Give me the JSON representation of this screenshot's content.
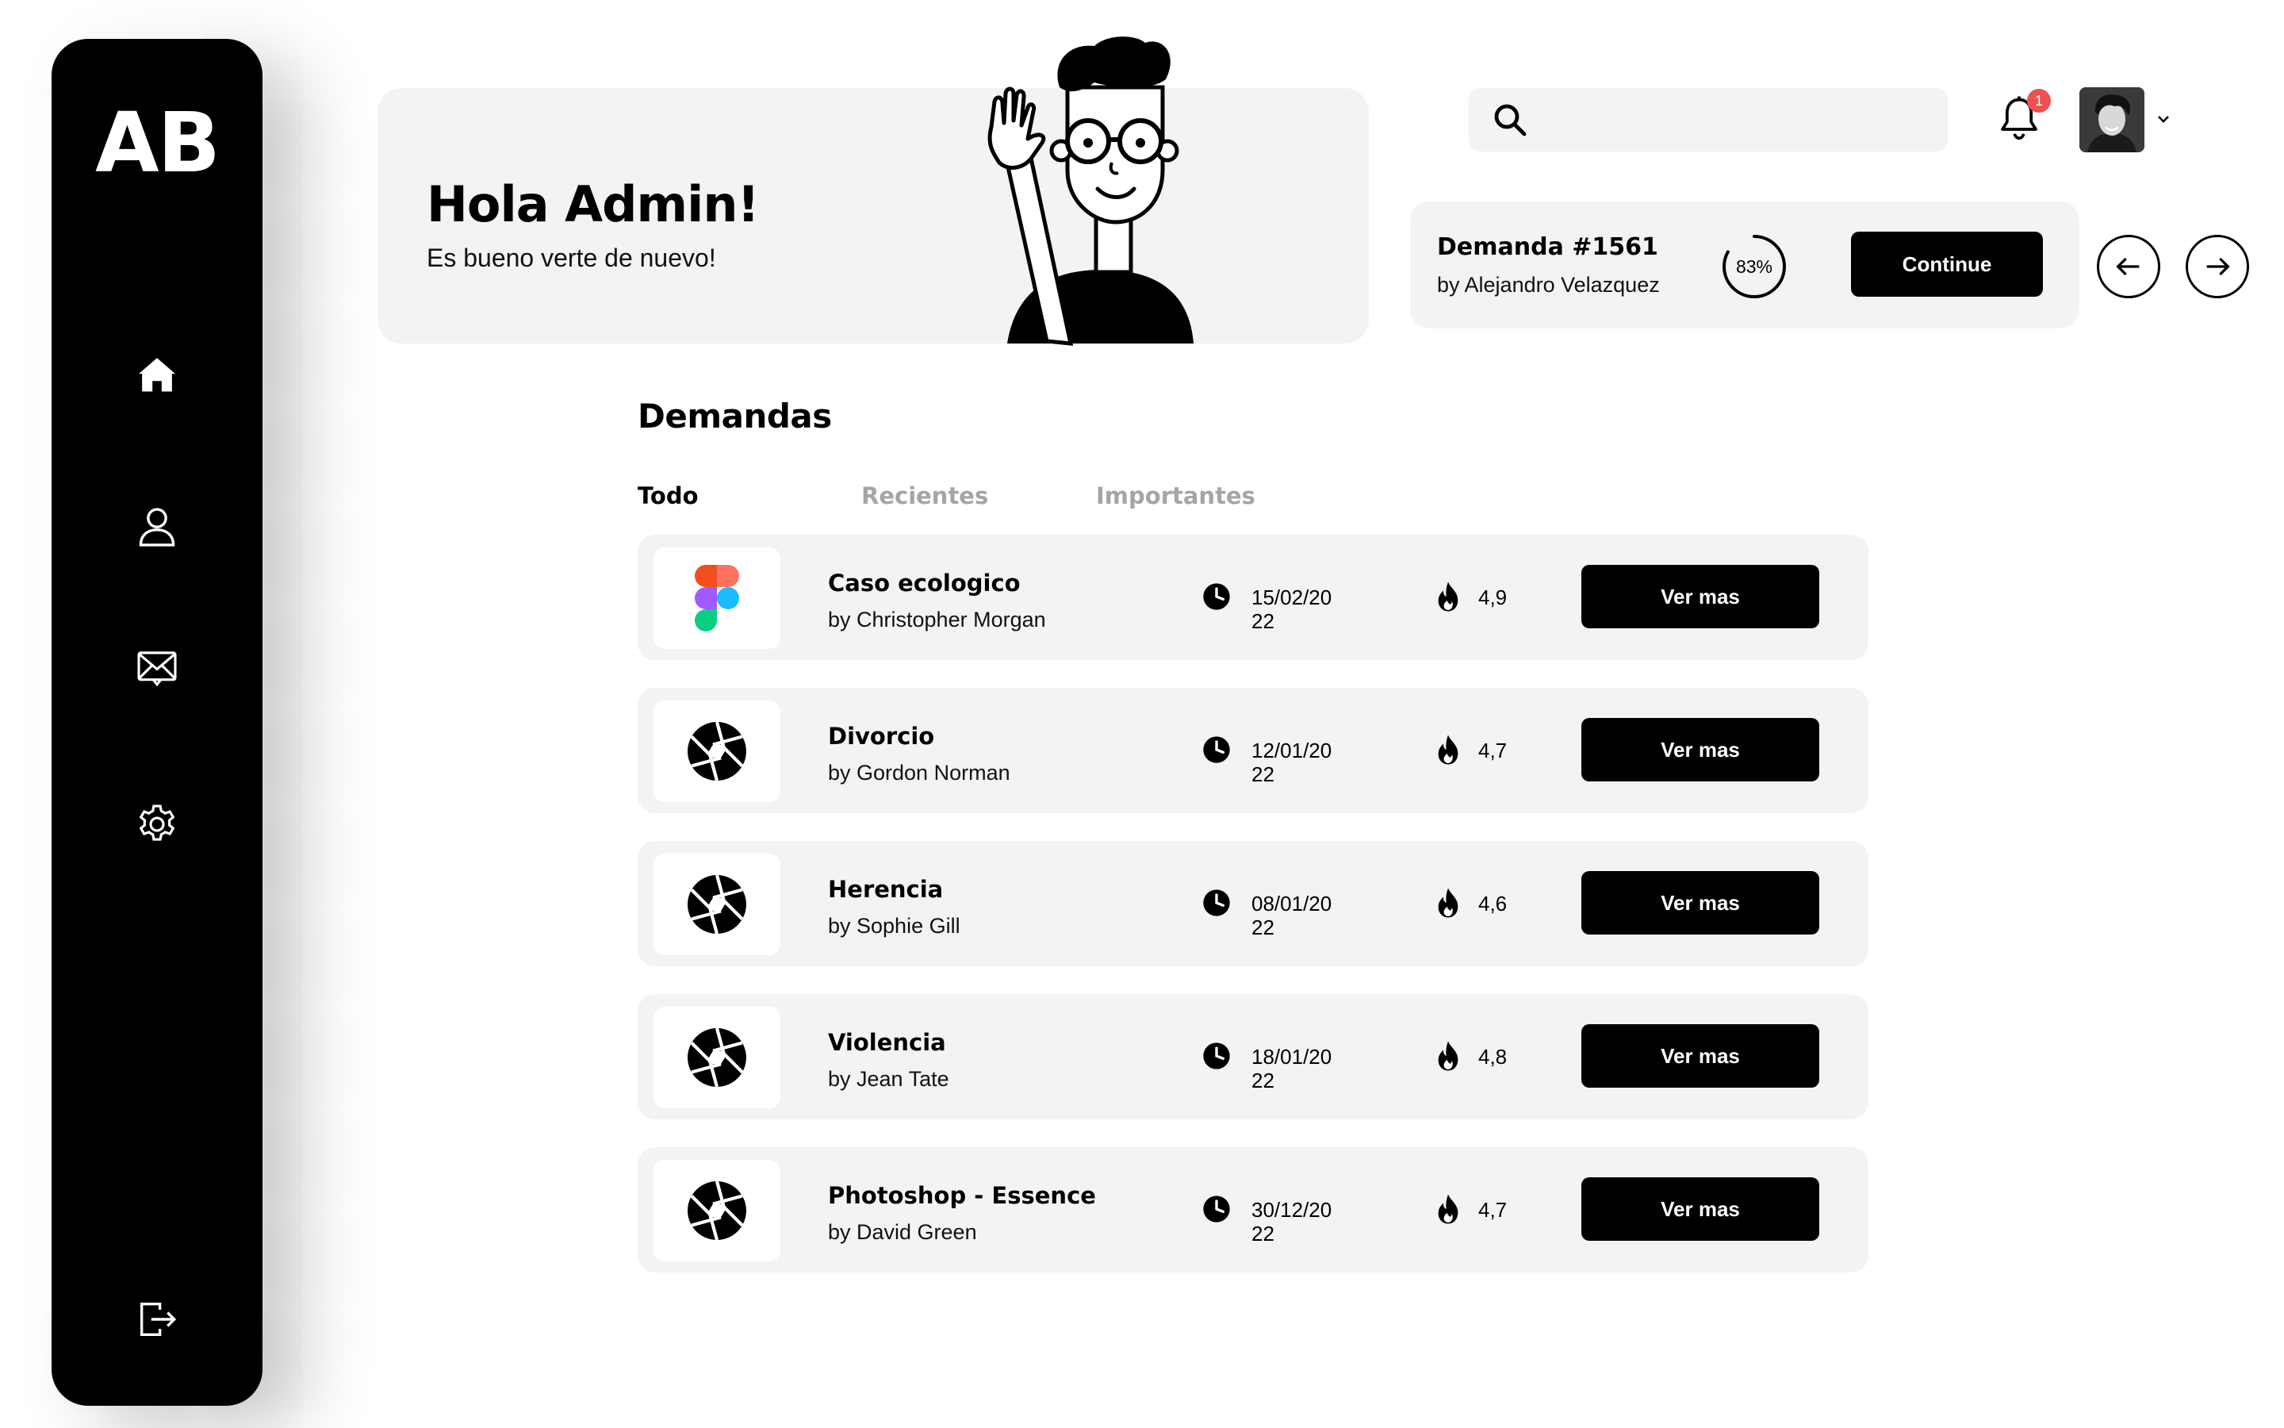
{
  "sidebar": {
    "logo": "AB",
    "items": [
      {
        "name": "home-icon"
      },
      {
        "name": "user-icon"
      },
      {
        "name": "mail-icon"
      },
      {
        "name": "gear-icon"
      },
      {
        "name": "logout-icon"
      }
    ],
    "active_color": "#ffffff"
  },
  "welcome": {
    "title": "Hola Admin!",
    "subtitle": "Es bueno verte de nuevo!"
  },
  "search": {
    "placeholder": "",
    "value": ""
  },
  "header": {
    "notification_count": "1",
    "badge_color": "#f0504f"
  },
  "current_demand": {
    "title": "Demanda #1561",
    "by": "by Alejandro Velazquez",
    "progress_label": "83%",
    "progress_value": 0.83,
    "continue_label": "Continue"
  },
  "demandas": {
    "title": "Demandas",
    "tabs": [
      {
        "label": "Todo",
        "active": true
      },
      {
        "label": "Recientes",
        "active": false
      },
      {
        "label": "Importantes",
        "active": false
      }
    ],
    "rows": [
      {
        "icon": "figma-icon",
        "title": "Caso ecologico",
        "by": "by Christopher Morgan",
        "date": "15/02/2022",
        "rating": "4,9",
        "button": "Ver mas"
      },
      {
        "icon": "aperture-icon",
        "title": "Divorcio",
        "by": "by Gordon Norman",
        "date": "12/01/2022",
        "rating": "4,7",
        "button": "Ver mas"
      },
      {
        "icon": "aperture-icon",
        "title": "Herencia",
        "by": "by Sophie Gill",
        "date": "08/01/2022",
        "rating": "4,6",
        "button": "Ver mas"
      },
      {
        "icon": "aperture-icon",
        "title": "Violencia",
        "by": "by Jean Tate",
        "date": "18/01/2022",
        "rating": "4,8",
        "button": "Ver mas"
      },
      {
        "icon": "aperture-icon",
        "title": "Photoshop - Essence",
        "by": "by David Green",
        "date": "30/12/2022",
        "rating": "4,7",
        "button": "Ver mas"
      }
    ]
  }
}
